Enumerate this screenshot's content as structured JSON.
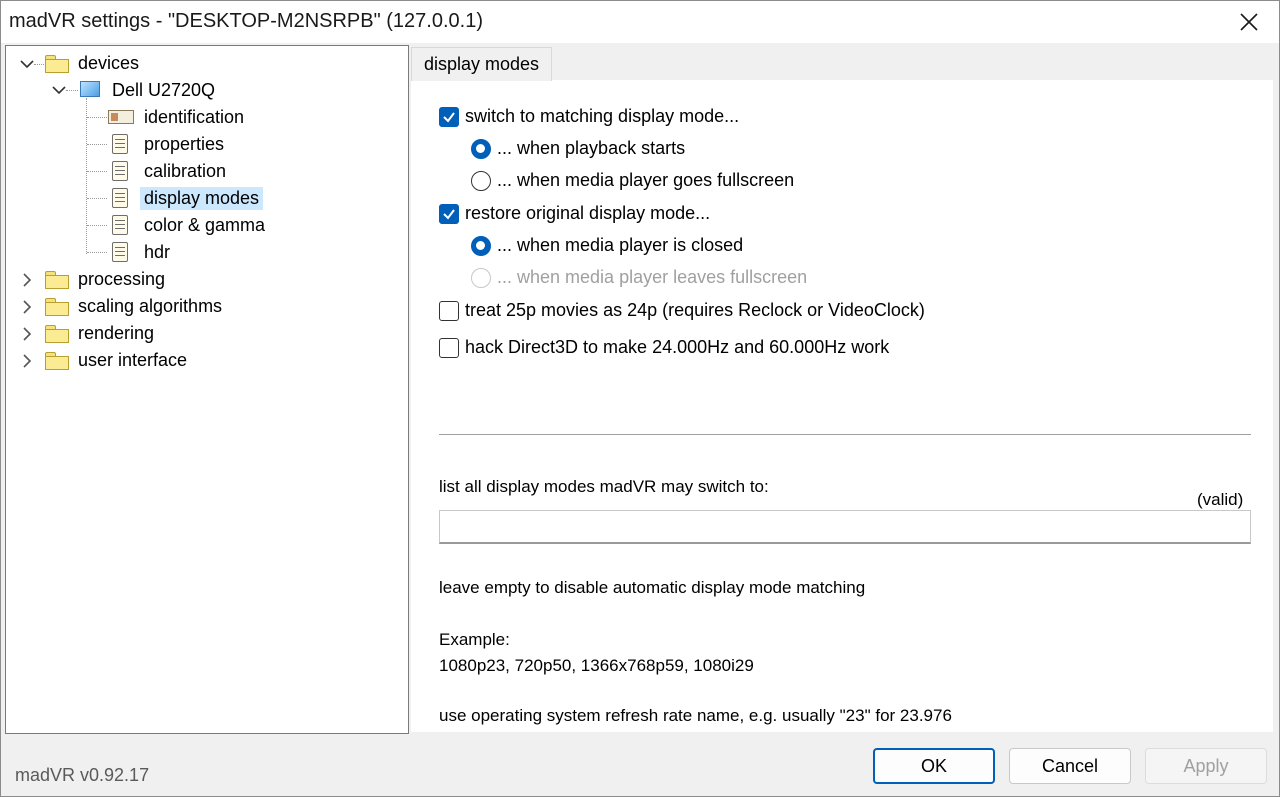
{
  "window": {
    "title": "madVR settings - \"DESKTOP-M2NSRPB\" (127.0.0.1)",
    "close_icon": "close-icon"
  },
  "tree": {
    "devices": "devices",
    "monitor": "Dell U2720Q",
    "items": {
      "identification": "identification",
      "properties": "properties",
      "calibration": "calibration",
      "display_modes": "display modes",
      "color_gamma": "color & gamma",
      "hdr": "hdr"
    },
    "processing": "processing",
    "scaling_algorithms": "scaling algorithms",
    "rendering": "rendering",
    "user_interface": "user interface"
  },
  "tab": {
    "label": "display modes"
  },
  "options": {
    "switch_matching": "switch to matching display mode...",
    "when_playback_starts": "... when playback starts",
    "when_fullscreen": "... when media player goes fullscreen",
    "restore_original": "restore original display mode...",
    "when_closed": "... when media player is closed",
    "when_leaves_fullscreen": "... when media player leaves fullscreen",
    "treat_25p": "treat 25p movies as 24p  (requires Reclock or VideoClock)",
    "hack_direct3d": "hack Direct3D to make 24.000Hz and 60.000Hz work"
  },
  "state": {
    "switch_matching": true,
    "playback_starts": true,
    "restore_original": true,
    "when_closed": true,
    "treat_25p": false,
    "hack_direct3d": false
  },
  "modes": {
    "list_label": "list all display modes madVR may switch to:",
    "valid": "(valid)",
    "value": "",
    "hint": "leave empty to disable automatic display mode matching",
    "example_label": "Example:",
    "example_value": "1080p23, 720p50, 1366x768p59, 1080i29",
    "note": "use operating system refresh rate name, e.g. usually \"23\" for 23.976"
  },
  "footer": {
    "version": "madVR v0.92.17",
    "ok": "OK",
    "cancel": "Cancel",
    "apply": "Apply"
  },
  "colors": {
    "accent": "#005fb8",
    "selection": "#cce8ff"
  }
}
